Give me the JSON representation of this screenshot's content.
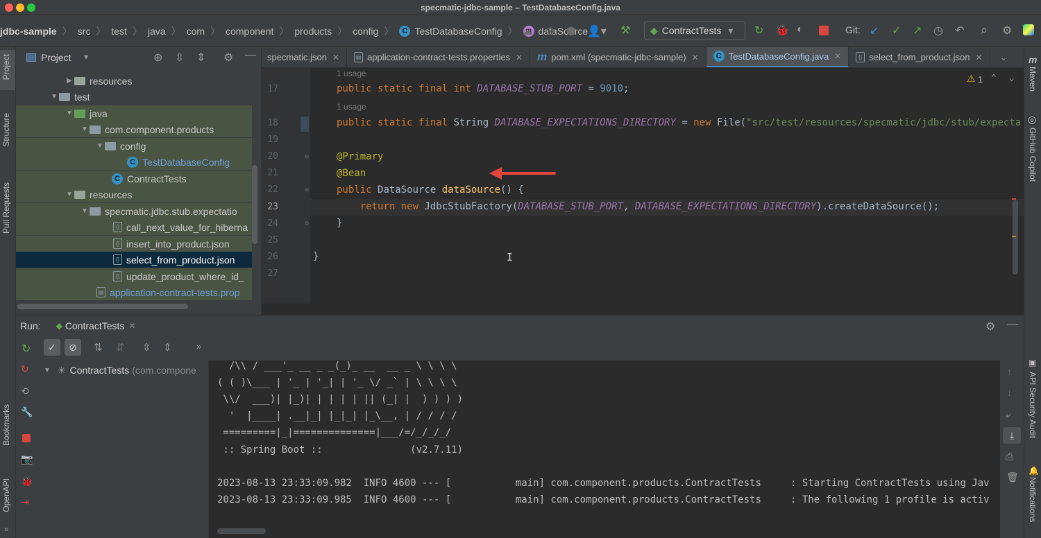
{
  "window": {
    "title": "specmatic-jdbc-sample – TestDatabaseConfig.java"
  },
  "breadcrumb": [
    "jdbc-sample",
    "src",
    "test",
    "java",
    "com",
    "component",
    "products",
    "config",
    "TestDatabaseConfig",
    "dataSource"
  ],
  "run_config": "ContractTests",
  "git_label": "Git:",
  "project_panel": {
    "title": "Project",
    "tree": [
      {
        "label": "resources"
      },
      {
        "label": "test"
      },
      {
        "label": "java"
      },
      {
        "label": "com.component.products"
      },
      {
        "label": "config"
      },
      {
        "label": "TestDatabaseConfig"
      },
      {
        "label": "ContractTests"
      },
      {
        "label": "resources"
      },
      {
        "label": "specmatic.jdbc.stub.expectatio"
      },
      {
        "label": "call_next_value_for_hiberna"
      },
      {
        "label": "insert_into_product.json"
      },
      {
        "label": "select_from_product.json"
      },
      {
        "label": "update_product_where_id_"
      },
      {
        "label": "application-contract-tests.prop"
      }
    ]
  },
  "left_tabs": [
    "Project",
    "Structure",
    "Pull Requests",
    "Bookmarks",
    "OpenAPI"
  ],
  "right_tabs": [
    "Maven",
    "GitHub Copilot",
    "API Security Audit",
    "Notifications"
  ],
  "tabs": [
    {
      "label": "specmatic.json"
    },
    {
      "label": "application-contract-tests.properties"
    },
    {
      "label": "pom.xml (specmatic-jdbc-sample)"
    },
    {
      "label": "TestDatabaseConfig.java"
    },
    {
      "label": "select_from_product.json"
    }
  ],
  "editor": {
    "warning_count": "1",
    "usage_label": "1 usage",
    "line_numbers": [
      "17",
      "18",
      "19",
      "20",
      "21",
      "22",
      "23",
      "24",
      "25",
      "26",
      "27"
    ]
  },
  "run_panel": {
    "label": "Run:",
    "tab": "ContractTests",
    "tree_item": "ContractTests",
    "tree_item_detail": "(com.compone",
    "console": [
      "  /\\\\ / ___'_ __ _ _(_)_ __  __ _ \\ \\ \\ \\",
      "( ( )\\___ | '_ | '_| | '_ \\/ _` | \\ \\ \\ \\",
      " \\\\/  ___)| |_)| | | | | || (_| |  ) ) ) )",
      "  '  |____| .__|_| |_|_| |_\\__, | / / / /",
      " =========|_|==============|___/=/_/_/_/",
      " :: Spring Boot ::               (v2.7.11)",
      "",
      "2023-08-13 23:33:09.982  INFO 4600 --- [           main] com.component.products.ContractTests     : Starting ContractTests using Jav",
      "2023-08-13 23:33:09.985  INFO 4600 --- [           main] com.component.products.ContractTests     : The following 1 profile is activ"
    ]
  },
  "colors": {
    "accent": "#4a88c7",
    "annotation_arrow": "#e5453f"
  }
}
